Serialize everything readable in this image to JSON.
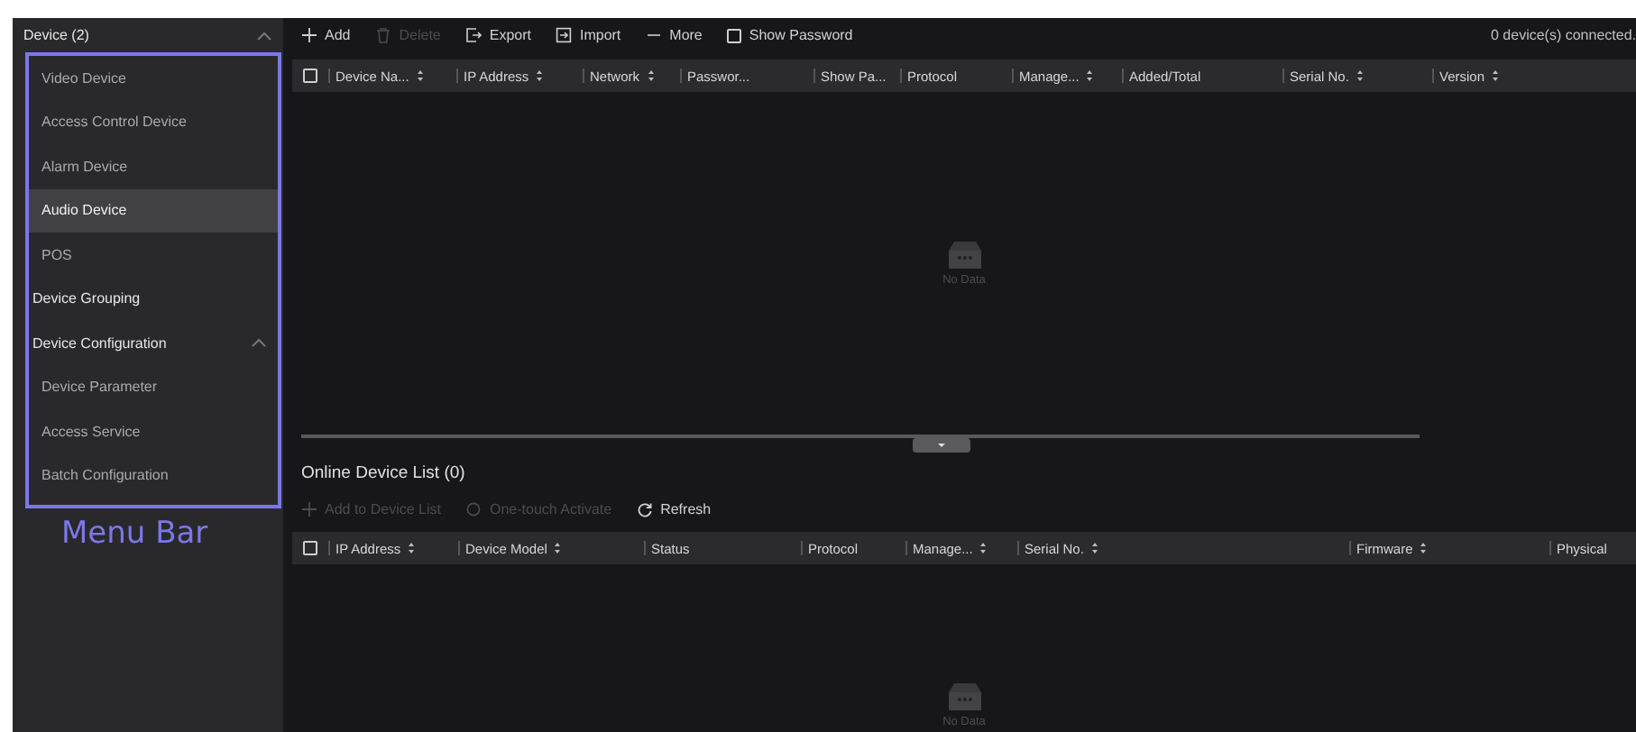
{
  "sidebar": {
    "header": {
      "label": "Device (2)",
      "expanded": true
    },
    "items": [
      {
        "label": "Video Device",
        "kind": "item",
        "selected": false
      },
      {
        "label": "Access Control Device",
        "kind": "item",
        "selected": false
      },
      {
        "label": "Alarm Device",
        "kind": "item",
        "selected": false
      },
      {
        "label": "Audio Device",
        "kind": "item",
        "selected": true
      },
      {
        "label": "POS",
        "kind": "item",
        "selected": false
      },
      {
        "label": "Device Grouping",
        "kind": "group",
        "selected": false
      },
      {
        "label": "Device Configuration",
        "kind": "group",
        "selected": false,
        "expanded": true,
        "children": [
          {
            "label": "Device Parameter",
            "kind": "item",
            "selected": false
          },
          {
            "label": "Access Service",
            "kind": "item",
            "selected": false
          },
          {
            "label": "Batch Configuration",
            "kind": "item",
            "selected": false
          }
        ]
      }
    ]
  },
  "annotation": {
    "label": "Menu Bar"
  },
  "device_panel": {
    "toolbar": [
      {
        "label": "Add",
        "kind": "plus",
        "disabled": false
      },
      {
        "label": "Delete",
        "kind": "trash",
        "disabled": true
      },
      {
        "label": "Export",
        "kind": "export",
        "disabled": false
      },
      {
        "label": "Import",
        "kind": "import",
        "disabled": false
      },
      {
        "label": "More",
        "kind": "more",
        "disabled": false
      },
      {
        "label": "Show Password",
        "kind": "checkbox",
        "disabled": false,
        "checked": false
      }
    ],
    "status": "0 device(s) connected.",
    "table": {
      "checked": false,
      "columns": [
        {
          "label": "Device Na...",
          "sortable": true
        },
        {
          "label": "IP Address",
          "sortable": true
        },
        {
          "label": "Network",
          "sortable": true
        },
        {
          "label": "Passwor...",
          "sortable": false
        },
        {
          "label": "Show Pa...",
          "sortable": false
        },
        {
          "label": "Protocol",
          "sortable": false
        },
        {
          "label": "Manage...",
          "sortable": true
        },
        {
          "label": "Added/Total",
          "sortable": false
        },
        {
          "label": "Serial No.",
          "sortable": true
        },
        {
          "label": "Version",
          "sortable": true
        }
      ],
      "empty_text": "No Data"
    }
  },
  "online_panel": {
    "title": "Online Device List (0)",
    "toolbar": [
      {
        "label": "Add to Device List",
        "kind": "plus",
        "disabled": true
      },
      {
        "label": "One-touch Activate",
        "kind": "activate",
        "disabled": true
      },
      {
        "label": "Refresh",
        "kind": "refresh",
        "disabled": false
      }
    ],
    "table": {
      "checked": false,
      "columns": [
        {
          "label": "IP Address",
          "sortable": true
        },
        {
          "label": "Device Model",
          "sortable": true
        },
        {
          "label": "Status",
          "sortable": false
        },
        {
          "label": "Protocol",
          "sortable": false
        },
        {
          "label": "Manage...",
          "sortable": true
        },
        {
          "label": "Serial No.",
          "sortable": true
        },
        {
          "label": "Firmware",
          "sortable": true
        },
        {
          "label": "Physical",
          "sortable": false
        }
      ],
      "empty_text": "No Data"
    }
  }
}
